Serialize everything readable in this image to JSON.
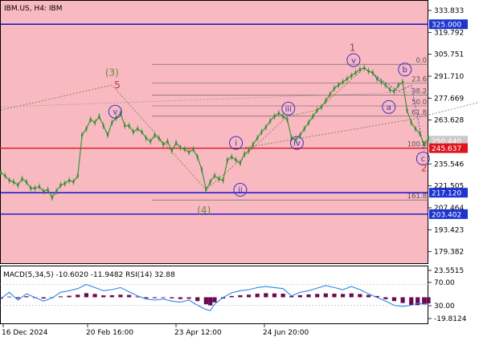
{
  "header": {
    "symbol_label": "IBM.US, H4:  IBM"
  },
  "colors": {
    "price_bg": "#f9b9c1",
    "macd_bg": "#ffffff",
    "candle": "#2f8f2f",
    "wave_label": "#3a33c4",
    "primary_label": "#b23a3a",
    "secondary_label": "#6b8a3a",
    "blue_line": "#0000d4",
    "red_line": "#e0141e",
    "fib": "#555555",
    "histogram": "#6a0a4f",
    "rsi_line": "#2a86e8",
    "badge_blue": "#1c34d0",
    "badge_red": "#e0141e",
    "badge_gray": "#c9c9c9"
  },
  "chart_data": [
    {
      "type": "line",
      "title": "IBM.US, H4:  IBM",
      "series": [
        {
          "values": [
            [
              0,
              230
            ],
            [
              4,
              228
            ],
            [
              8,
              225
            ],
            [
              12,
              224
            ],
            [
              16,
              222
            ],
            [
              20,
              226
            ],
            [
              24,
              224
            ],
            [
              28,
              220
            ],
            [
              32,
              220
            ],
            [
              36,
              221
            ],
            [
              40,
              218
            ],
            [
              44,
              219
            ],
            [
              48,
              214
            ],
            [
              52,
              218
            ],
            [
              56,
              222
            ],
            [
              60,
              223
            ],
            [
              64,
              225
            ],
            [
              68,
              224
            ],
            [
              72,
              228
            ],
            [
              76,
              254
            ],
            [
              80,
              258
            ],
            [
              84,
              264
            ],
            [
              88,
              262
            ],
            [
              92,
              266
            ],
            [
              96,
              260
            ],
            [
              100,
              254
            ],
            [
              104,
              262
            ],
            [
              108,
              265
            ],
            [
              112,
              268
            ],
            [
              116,
              260
            ],
            [
              120,
              260
            ],
            [
              124,
              256
            ],
            [
              128,
              258
            ],
            [
              132,
              256
            ],
            [
              136,
              252
            ],
            [
              140,
              250
            ],
            [
              144,
              254
            ],
            [
              148,
              252
            ],
            [
              152,
              248
            ],
            [
              156,
              250
            ],
            [
              160,
              244
            ],
            [
              164,
              249
            ],
            [
              168,
              246
            ],
            [
              172,
              245
            ],
            [
              176,
              243
            ],
            [
              180,
              245
            ],
            [
              184,
              240
            ],
            [
              188,
              232
            ],
            [
              192,
              219
            ],
            [
              196,
              224
            ],
            [
              200,
              228
            ],
            [
              204,
              226
            ],
            [
              208,
              225
            ],
            [
              212,
              238
            ],
            [
              216,
              240
            ],
            [
              220,
              238
            ],
            [
              224,
              236
            ],
            [
              228,
              242
            ],
            [
              232,
              244
            ],
            [
              236,
              248
            ],
            [
              240,
              252
            ],
            [
              244,
              256
            ],
            [
              248,
              259
            ],
            [
              252,
              263
            ],
            [
              256,
              266
            ],
            [
              260,
              268
            ],
            [
              264,
              266
            ],
            [
              268,
              264
            ],
            [
              272,
              252
            ],
            [
              276,
              251
            ],
            [
              280,
              254
            ],
            [
              284,
              258
            ],
            [
              288,
              262
            ],
            [
              292,
              266
            ],
            [
              296,
              270
            ],
            [
              300,
              272
            ],
            [
              304,
              276
            ],
            [
              308,
              280
            ],
            [
              312,
              284
            ],
            [
              316,
              286
            ],
            [
              320,
              288
            ],
            [
              324,
              290
            ],
            [
              328,
              292
            ],
            [
              332,
              294
            ],
            [
              336,
              296
            ],
            [
              340,
              297
            ],
            [
              344,
              295
            ],
            [
              348,
              294
            ],
            [
              352,
              290
            ],
            [
              356,
              288
            ],
            [
              360,
              286
            ],
            [
              364,
              283
            ],
            [
              368,
              282
            ],
            [
              372,
              286
            ],
            [
              376,
              288
            ],
            [
              380,
              270
            ],
            [
              384,
              262
            ],
            [
              388,
              258
            ],
            [
              392,
              255
            ],
            [
              396,
              248
            ],
            [
              400,
              252
            ]
          ]
        }
      ],
      "y_ticks": [
        "333.833",
        "319.792",
        "305.751",
        "291.710",
        "277.669",
        "263.628",
        "235.546",
        "221.505",
        "207.464",
        "193.423",
        "179.382"
      ],
      "x_ticks": [
        "16 Dec 2024",
        "20 Feb 16:00",
        "23 Apr 12:00",
        "24 Jun 20:00"
      ],
      "ylim": [
        172,
        340
      ],
      "price_badges": [
        {
          "label": "325.000",
          "value": 325.0,
          "color": "blue"
        },
        {
          "label": "250.440",
          "value": 250.44,
          "color": "gray"
        },
        {
          "label": "245.637",
          "value": 245.637,
          "color": "red"
        },
        {
          "label": "217.120",
          "value": 217.12,
          "color": "blue"
        },
        {
          "label": "203.402",
          "value": 203.402,
          "color": "blue"
        }
      ],
      "horizontal_lines": [
        {
          "value": 325.0,
          "color": "blue"
        },
        {
          "value": 245.637,
          "color": "red"
        },
        {
          "value": 217.12,
          "color": "blue"
        },
        {
          "value": 203.402,
          "color": "blue"
        }
      ],
      "fib_levels": [
        {
          "label": "0.0",
          "value": 299.3
        },
        {
          "label": "23.6",
          "value": 287.4
        },
        {
          "label": "38.2",
          "value": 279.6
        },
        {
          "label": "50.0",
          "value": 272.7
        },
        {
          "label": "61.8",
          "value": 266.1
        },
        {
          "label": "100.0",
          "value": 245.8
        },
        {
          "label": "161.8",
          "value": 212.5
        }
      ],
      "wave_labels": [
        {
          "text": "(3)",
          "x": 104,
          "y": 294,
          "style": "secondary"
        },
        {
          "text": "5",
          "x": 109,
          "y": 286,
          "style": "primary"
        },
        {
          "text": "v",
          "x": 107,
          "y": 269,
          "style": "circled"
        },
        {
          "text": "(4)",
          "x": 190,
          "y": 206,
          "style": "secondary"
        },
        {
          "text": "i",
          "x": 220,
          "y": 249,
          "style": "circled"
        },
        {
          "text": "ii",
          "x": 224,
          "y": 219,
          "style": "circled"
        },
        {
          "text": "iii",
          "x": 269,
          "y": 271,
          "style": "circled"
        },
        {
          "text": "iv",
          "x": 277,
          "y": 249,
          "style": "circled"
        },
        {
          "text": "1",
          "x": 329,
          "y": 310,
          "style": "primary"
        },
        {
          "text": "v",
          "x": 330,
          "y": 302,
          "style": "circled"
        },
        {
          "text": "b",
          "x": 378,
          "y": 296,
          "style": "circled"
        },
        {
          "text": "a",
          "x": 363,
          "y": 272,
          "style": "circled"
        },
        {
          "text": "c",
          "x": 395,
          "y": 239,
          "style": "circled"
        },
        {
          "text": "2",
          "x": 396,
          "y": 233,
          "style": "primary"
        }
      ]
    },
    {
      "type": "bar",
      "title": "MACD(5,34,5) -10.6020 -11.9482 RSI(14) 32.88",
      "series": [
        {
          "name": "MACD",
          "values": [
            [
              0,
              -1.2
            ],
            [
              8,
              0.5
            ],
            [
              16,
              -0.9
            ],
            [
              24,
              0.8
            ],
            [
              32,
              -0.6
            ],
            [
              40,
              -1.0
            ],
            [
              48,
              -0.4
            ],
            [
              56,
              0.7
            ],
            [
              64,
              1.2
            ],
            [
              72,
              2.0
            ],
            [
              80,
              3.2
            ],
            [
              88,
              2.6
            ],
            [
              96,
              1.5
            ],
            [
              104,
              1.6
            ],
            [
              112,
              2.0
            ],
            [
              120,
              1.8
            ],
            [
              128,
              0.6
            ],
            [
              136,
              -0.9
            ],
            [
              144,
              -0.7
            ],
            [
              152,
              -0.5
            ],
            [
              160,
              -0.9
            ],
            [
              168,
              -1.4
            ],
            [
              176,
              -1.2
            ],
            [
              184,
              -3.0
            ],
            [
              192,
              -5.5
            ],
            [
              196,
              -6.5
            ],
            [
              200,
              -4.0
            ],
            [
              208,
              -1.0
            ],
            [
              216,
              1.0
            ],
            [
              224,
              1.6
            ],
            [
              232,
              2.0
            ],
            [
              240,
              2.8
            ],
            [
              248,
              3.2
            ],
            [
              256,
              3.0
            ],
            [
              264,
              2.8
            ],
            [
              272,
              1.0
            ],
            [
              280,
              1.6
            ],
            [
              288,
              2.2
            ],
            [
              296,
              2.6
            ],
            [
              304,
              3.0
            ],
            [
              312,
              2.8
            ],
            [
              320,
              2.6
            ],
            [
              328,
              3.0
            ],
            [
              336,
              2.5
            ],
            [
              344,
              1.8
            ],
            [
              352,
              1.0
            ],
            [
              360,
              -1.5
            ],
            [
              368,
              -3.0
            ],
            [
              376,
              -4.5
            ],
            [
              384,
              -6.0
            ],
            [
              390,
              -6.2
            ],
            [
              396,
              -5.0
            ],
            [
              400,
              -4.8
            ]
          ]
        },
        {
          "name": "RSI",
          "values": [
            [
              0,
              43
            ],
            [
              8,
              55
            ],
            [
              16,
              40
            ],
            [
              24,
              52
            ],
            [
              32,
              45
            ],
            [
              40,
              38
            ],
            [
              48,
              44
            ],
            [
              56,
              55
            ],
            [
              64,
              58
            ],
            [
              72,
              62
            ],
            [
              80,
              70
            ],
            [
              88,
              64
            ],
            [
              96,
              58
            ],
            [
              104,
              60
            ],
            [
              112,
              64
            ],
            [
              120,
              56
            ],
            [
              128,
              48
            ],
            [
              136,
              42
            ],
            [
              144,
              40
            ],
            [
              152,
              42
            ],
            [
              160,
              38
            ],
            [
              168,
              36
            ],
            [
              176,
              40
            ],
            [
              184,
              30
            ],
            [
              192,
              22
            ],
            [
              196,
              20
            ],
            [
              200,
              32
            ],
            [
              208,
              45
            ],
            [
              216,
              54
            ],
            [
              224,
              58
            ],
            [
              232,
              60
            ],
            [
              240,
              64
            ],
            [
              248,
              66
            ],
            [
              256,
              64
            ],
            [
              264,
              62
            ],
            [
              272,
              48
            ],
            [
              280,
              55
            ],
            [
              288,
              58
            ],
            [
              296,
              63
            ],
            [
              304,
              68
            ],
            [
              312,
              64
            ],
            [
              320,
              60
            ],
            [
              328,
              66
            ],
            [
              336,
              60
            ],
            [
              344,
              52
            ],
            [
              352,
              45
            ],
            [
              360,
              38
            ],
            [
              368,
              30
            ],
            [
              376,
              28
            ],
            [
              384,
              30
            ],
            [
              390,
              34
            ],
            [
              396,
              32
            ],
            [
              400,
              33
            ]
          ]
        }
      ],
      "y_ticks": [
        "23.5515",
        "70.00",
        "30.00",
        "-19.8124"
      ],
      "ylim": [
        -19.8124,
        23.5515
      ]
    }
  ]
}
